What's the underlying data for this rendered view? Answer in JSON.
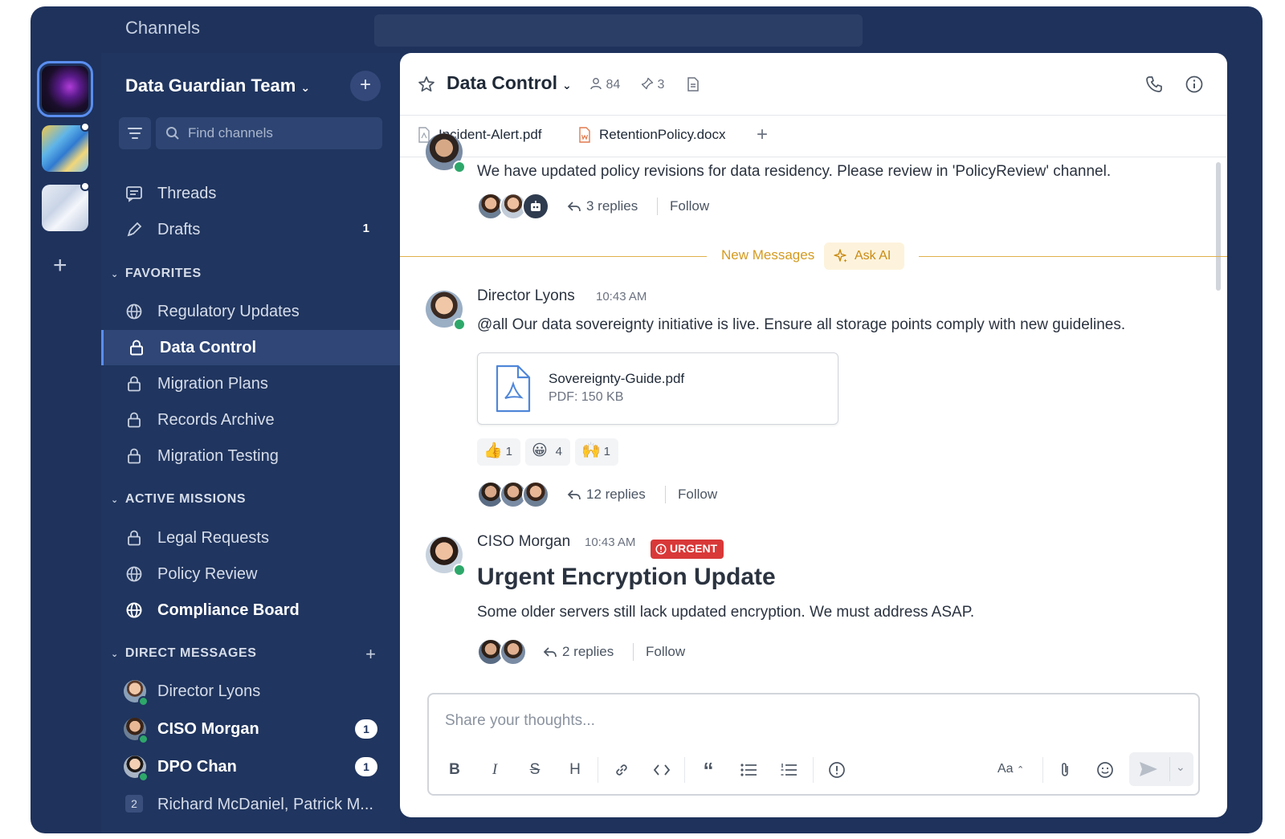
{
  "topbar": {
    "title": "Channels"
  },
  "teams": [
    {
      "name": "team-1",
      "active": true
    },
    {
      "name": "team-2",
      "unread": true
    },
    {
      "name": "team-3",
      "unread": true
    }
  ],
  "sidebar": {
    "team_name": "Data Guardian Team",
    "find_placeholder": "Find channels",
    "threads_label": "Threads",
    "drafts_label": "Drafts",
    "drafts_count": "1",
    "sections": {
      "favorites": "FAVORITES",
      "active_missions": "ACTIVE MISSIONS",
      "direct_messages": "DIRECT MESSAGES"
    },
    "favorites": [
      {
        "label": "Regulatory Updates",
        "icon": "globe-icon"
      },
      {
        "label": "Data Control",
        "icon": "lock-icon",
        "active": true
      },
      {
        "label": "Migration Plans",
        "icon": "lock-icon"
      },
      {
        "label": "Records Archive",
        "icon": "lock-icon"
      },
      {
        "label": "Migration Testing",
        "icon": "lock-icon"
      }
    ],
    "active_missions": [
      {
        "label": "Legal Requests",
        "icon": "lock-icon"
      },
      {
        "label": "Policy Review",
        "icon": "globe-icon"
      },
      {
        "label": "Compliance Board",
        "icon": "globe-icon",
        "bold": true
      }
    ],
    "direct_messages": [
      {
        "label": "Director Lyons"
      },
      {
        "label": "CISO Morgan",
        "badge": "1"
      },
      {
        "label": "DPO Chan",
        "badge": "1"
      },
      {
        "label": "Richard McDaniel, Patrick M...",
        "group_count": "2"
      }
    ]
  },
  "channel": {
    "name": "Data Control",
    "members": "84",
    "pinned": "3",
    "tabs": [
      {
        "label": "Incident-Alert.pdf"
      },
      {
        "label": "RetentionPolicy.docx"
      }
    ]
  },
  "messages": {
    "first": {
      "text": "We have updated policy revisions for data residency. Please review in 'PolicyReview' channel.",
      "replies": "3 replies",
      "follow": "Follow"
    },
    "divider": {
      "label": "New Messages",
      "ask_ai": "Ask AI"
    },
    "lyons": {
      "sender": "Director Lyons",
      "time": "10:43 AM",
      "text": "@all Our data sovereignty initiative is live. Ensure all storage points comply with new guidelines.",
      "file_name": "Sovereignty-Guide.pdf",
      "file_meta": "PDF: 150 KB",
      "reactions": [
        {
          "emoji": "👍",
          "count": "1"
        },
        {
          "emoji": "😀",
          "count": "4"
        },
        {
          "emoji": "🙌",
          "count": "1"
        }
      ],
      "replies": "12 replies",
      "follow": "Follow"
    },
    "morgan": {
      "sender": "CISO Morgan",
      "time": "10:43 AM",
      "badge": "URGENT",
      "headline": "Urgent Encryption Update",
      "text": "Some older servers still lack updated encryption. We must address ASAP.",
      "replies": "2 replies",
      "follow": "Follow"
    }
  },
  "composer": {
    "placeholder": "Share your thoughts...",
    "format_toggle": "Aa"
  },
  "colors": {
    "window_bg": "#1e325c",
    "sidebar_bg": "#20355f",
    "accent": "#5a8ef0",
    "new_messages": "#d49a1e",
    "urgent": "#d93838",
    "online": "#2ea86a"
  }
}
